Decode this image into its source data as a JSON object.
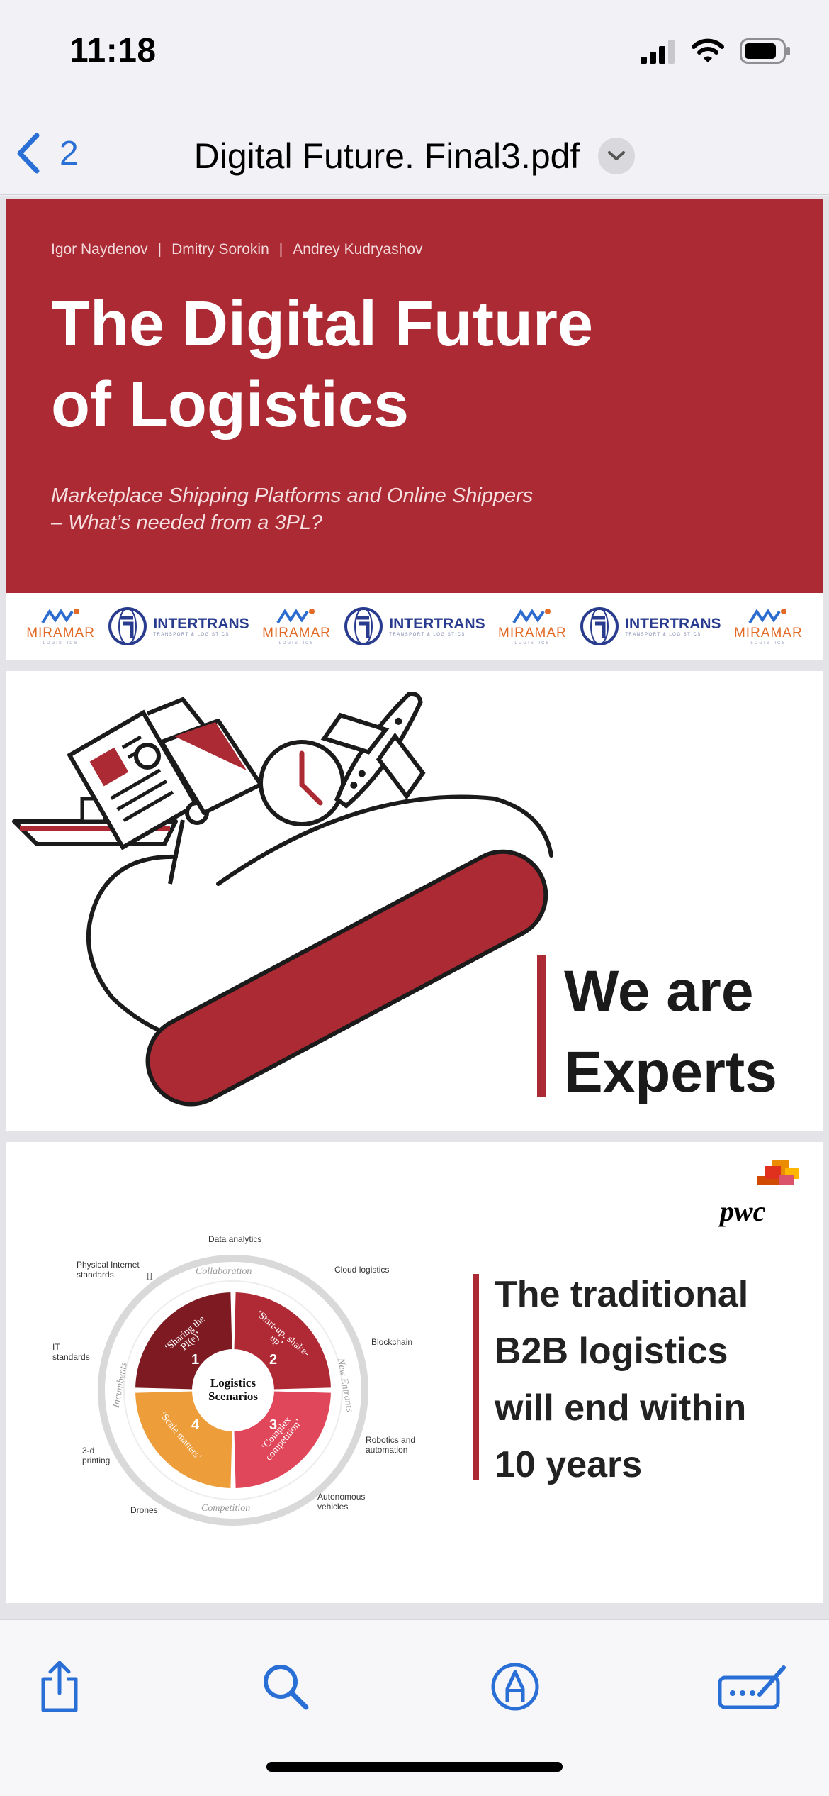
{
  "status": {
    "time": "11:18",
    "signal_bars": 3,
    "battery_level": 0.8
  },
  "nav": {
    "back_count": "2",
    "title": "Digital Future. Final3.pdf"
  },
  "page1": {
    "authors": [
      "Igor Naydenov",
      "Dmitry Sorokin",
      "Andrey Kudryashov"
    ],
    "author_separator": "|",
    "title_line1": "The Digital Future",
    "title_line2": "of Logistics",
    "subtitle_line1": "Marketplace Shipping Platforms and Online Shippers",
    "subtitle_line2": "– What’s needed from a 3PL?",
    "logos": {
      "miramar_name": "MIRAMAR",
      "miramar_sub": "LOGISTICS",
      "intertrans_name": "INTERTRANS",
      "intertrans_sub": "TRANSPORT & LOGISTICS"
    }
  },
  "page2": {
    "line1": "We are",
    "line2": "Experts"
  },
  "page3": {
    "brand": "pwc",
    "claim": [
      "The traditional",
      "B2B logistics",
      "will end within",
      "10 years"
    ],
    "wheel": {
      "center_line1": "Logistics",
      "center_line2": "Scenarios",
      "quadrants": [
        {
          "num": "1",
          "label": "‘Sharing the PI(e)’",
          "color": "#7d1a22"
        },
        {
          "num": "2",
          "label": "‘Start-up, shake-up’",
          "color": "#b02a35"
        },
        {
          "num": "3",
          "label": "‘Complex competition’",
          "color": "#e0475a"
        },
        {
          "num": "4",
          "label": "‘Scale matters’",
          "color": "#ee9d3b"
        }
      ],
      "ring_labels": {
        "top": "Collaboration",
        "right": "New Entrants",
        "bottom": "Competition",
        "left": "Incumbents",
        "top_left_numeral": "II"
      },
      "outer_labels": {
        "data_analytics": "Data analytics",
        "physical_internet": [
          "Physical Internet",
          "standards"
        ],
        "cloud_logistics": "Cloud logistics",
        "blockchain": "Blockchain",
        "it_standards": [
          "IT",
          "standards"
        ],
        "robotics": [
          "Robotics and",
          "automation"
        ],
        "printing": [
          "3-d",
          "printing"
        ],
        "autonomous": [
          "Autonomous",
          "vehicles"
        ],
        "drones": "Drones"
      }
    }
  },
  "colors": {
    "accent_red": "#ab2a33",
    "ios_blue": "#2a6fd6"
  },
  "toolbar": {
    "icons": [
      "share-icon",
      "search-icon",
      "markup-icon",
      "form-fill-icon"
    ]
  }
}
